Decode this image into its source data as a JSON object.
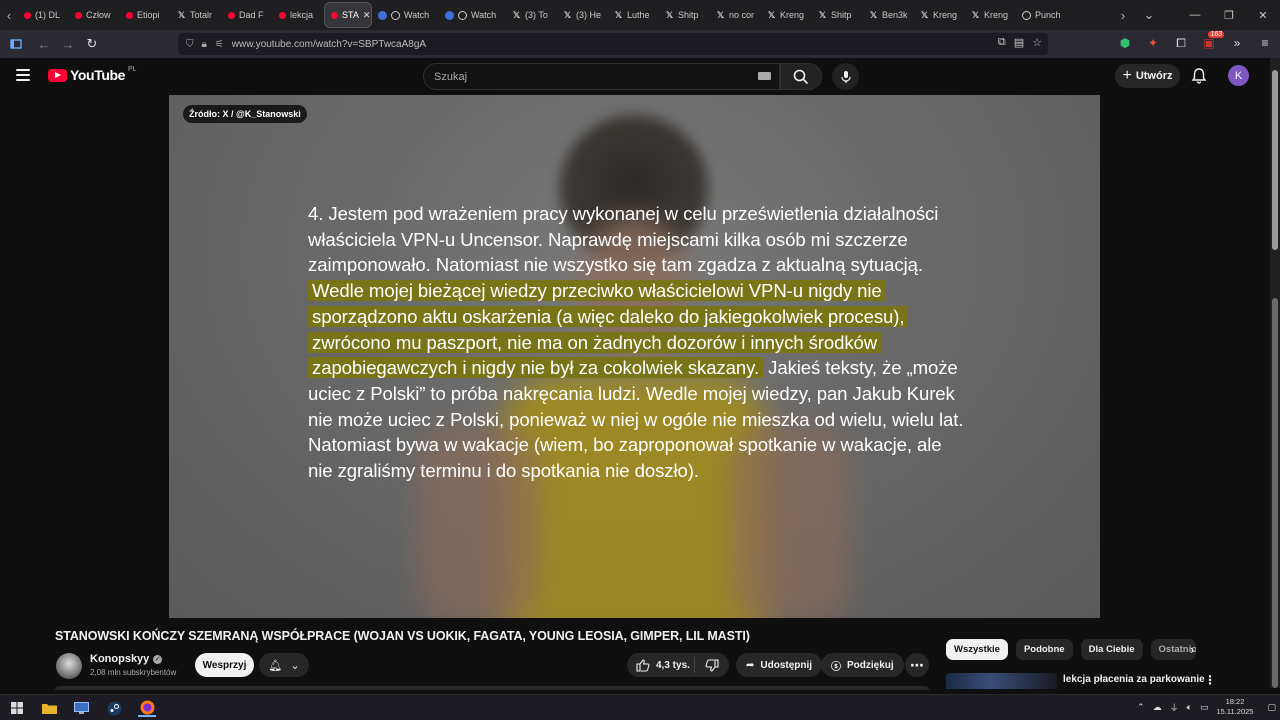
{
  "browser": {
    "tabs": [
      {
        "favicon": "youtube-icon",
        "label": "(1) DL"
      },
      {
        "favicon": "youtube-icon",
        "label": "Człow"
      },
      {
        "favicon": "youtube-icon",
        "label": "Etiopi"
      },
      {
        "favicon": "x-icon",
        "label": "Totalr"
      },
      {
        "favicon": "youtube-icon",
        "label": "Dad F"
      },
      {
        "favicon": "youtube-icon",
        "label": "lekcja"
      },
      {
        "favicon": "youtube-icon",
        "label": "STA",
        "active": true
      },
      {
        "favicon": "watch-icon",
        "label": "Watch"
      },
      {
        "favicon": "watch-icon",
        "label": "Watch"
      },
      {
        "favicon": "x-icon",
        "label": "(3) To"
      },
      {
        "favicon": "x-icon",
        "label": "(3) He"
      },
      {
        "favicon": "x-icon",
        "label": "Luthe"
      },
      {
        "favicon": "x-icon",
        "label": "Shitp"
      },
      {
        "favicon": "x-icon",
        "label": "no cor"
      },
      {
        "favicon": "x-icon",
        "label": "Kreng"
      },
      {
        "favicon": "x-icon",
        "label": "Shitp"
      },
      {
        "favicon": "x-icon",
        "label": "Ben3k"
      },
      {
        "favicon": "x-icon",
        "label": "Kreng"
      },
      {
        "favicon": "x-icon",
        "label": "Kreng"
      },
      {
        "favicon": "play-icon",
        "label": "Punch"
      }
    ],
    "url": "www.youtube.com/watch?v=SBPTwcaA8gA",
    "extension_badge": "163"
  },
  "youtube": {
    "logo_text": "YouTube",
    "country_code": "PL",
    "search_placeholder": "Szukaj",
    "create_label": "Utwórz",
    "avatar_letter": "K"
  },
  "video": {
    "source_tag": "Źródło: X / @K_Stanowski",
    "quote_normal_1": "4. Jestem pod wrażeniem pracy wykonanej w celu prześwietlenia działalności właściciela VPN-u Uncensor. Naprawdę miejscami kilka osób mi szczerze zaimponowało. Natomiast nie wszystko się tam zgadza z aktualną sytuacją.",
    "quote_highlight": "Wedle mojej bieżącej wiedzy przeciwko właścicielowi VPN-u nigdy nie sporządzono aktu oskarżenia (a więc daleko do jakiegokolwiek procesu), zwrócono mu paszport, nie ma on żadnych dozorów i innych środków zapobiegawczych i nigdy nie był za cokolwiek skazany.",
    "quote_normal_2": "Jakieś teksty, że „może uciec z Polski” to próba nakręcania ludzi. Wedle mojej wiedzy, pan Jakub Kurek nie może uciec z Polski, ponieważ w niej w ogóle nie mieszka od wielu, wielu lat. Natomiast bywa w wakacje (wiem, bo zaproponował spotkanie w wakacje, ale nie zgraliśmy terminu i do spotkania nie doszło)."
  },
  "details": {
    "title": "STANOWSKI KOŃCZY SZEMRANĄ WSPÓŁPRACE (WOJAN VS UOKIK, FAGATA, YOUNG LEOSIA, GIMPER, LIL MASTI)",
    "channel_name": "Konopskyy",
    "subscribers": "2,08 mln subskrybentów",
    "support_label": "Wesprzyj",
    "likes": "4,3 tys.",
    "share_label": "Udostępnij",
    "thanks_label": "Podziękuj"
  },
  "sidebar": {
    "chips": [
      "Wszystkie",
      "Podobne",
      "Dla Ciebie",
      "Ostatnio"
    ],
    "rec_title": "lekcja płacenia za parkowanie"
  },
  "taskbar": {
    "time": "18:22",
    "date": "15.11.2025"
  },
  "colors": {
    "highlight": "#7a7418",
    "youtube_red": "#ff0033",
    "avatar": "#7e57c2"
  }
}
